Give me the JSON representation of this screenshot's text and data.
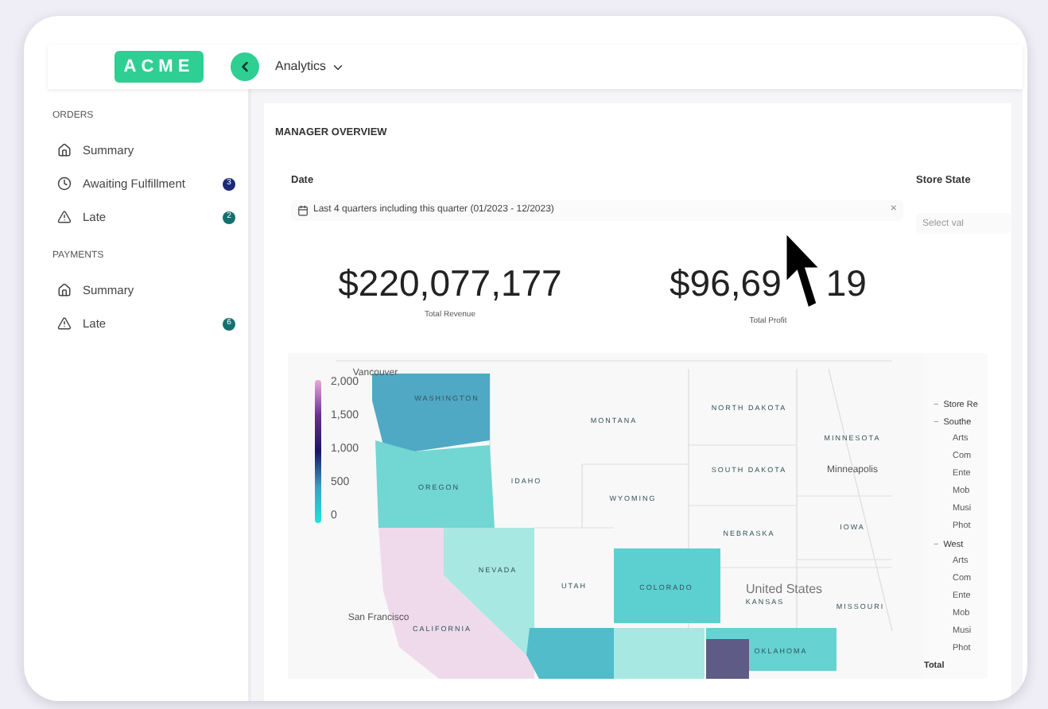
{
  "header": {
    "logo": "ACME",
    "menu": "Analytics"
  },
  "sidebar": {
    "sections": [
      {
        "title": "ORDERS",
        "items": [
          {
            "kind": "home",
            "label": "Summary"
          },
          {
            "kind": "clock",
            "label": "Awaiting Fulfillment",
            "badge": "3",
            "color": "#1e2a78"
          },
          {
            "kind": "warning",
            "label": "Late",
            "badge": "2",
            "color": "#14706e"
          }
        ]
      },
      {
        "title": "PAYMENTS",
        "items": [
          {
            "kind": "home",
            "label": "Summary"
          },
          {
            "kind": "warning",
            "label": "Late",
            "badge": "6",
            "color": "#14706e"
          }
        ]
      }
    ]
  },
  "page": {
    "title": "MANAGER OVERVIEW",
    "date_filter": {
      "label": "Date",
      "value": "Last 4 quarters including this quarter (01/2023 - 12/2023)",
      "clear": "×"
    },
    "store_filter": {
      "label": "Store State",
      "placeholder": "Select val"
    },
    "stats": [
      {
        "value_parts": [
          "$220,077,177"
        ],
        "caption": "Total Revenue"
      },
      {
        "value_parts": [
          "$96,69",
          "19"
        ],
        "caption": "Total Profit"
      }
    ],
    "legend": {
      "ticks": [
        "2,000",
        "1,500",
        "1,000",
        "500",
        "0"
      ]
    },
    "map_labels": [
      {
        "text": "Vancouver",
        "kind": "city"
      },
      {
        "text": "WASHINGTON",
        "kind": "state"
      },
      {
        "text": "MONTANA",
        "kind": "state"
      },
      {
        "text": "NORTH DAKOTA",
        "kind": "state"
      },
      {
        "text": "MINNESOTA",
        "kind": "state"
      },
      {
        "text": "SOUTH DAKOTA",
        "kind": "state"
      },
      {
        "text": "Minneapolis",
        "kind": "city"
      },
      {
        "text": "IDAHO",
        "kind": "state"
      },
      {
        "text": "OREGON",
        "kind": "state"
      },
      {
        "text": "WYOMING",
        "kind": "state"
      },
      {
        "text": "NEBRASKA",
        "kind": "state"
      },
      {
        "text": "IOWA",
        "kind": "state"
      },
      {
        "text": "NEVADA",
        "kind": "state"
      },
      {
        "text": "UTAH",
        "kind": "state"
      },
      {
        "text": "COLORADO",
        "kind": "state"
      },
      {
        "text": "United States",
        "kind": "country"
      },
      {
        "text": "KANSAS",
        "kind": "state"
      },
      {
        "text": "MISSOURI",
        "kind": "state"
      },
      {
        "text": "San Francisco",
        "kind": "city"
      },
      {
        "text": "CALIFORNIA",
        "kind": "state"
      },
      {
        "text": "OKLAHOMA",
        "kind": "state"
      }
    ],
    "tree": [
      {
        "toggle": "−",
        "label": "Store Re",
        "expanded": true
      },
      {
        "toggle": "−",
        "label": "Southe",
        "expanded": true,
        "children": [
          {
            "label": "Arts"
          },
          {
            "label": "Com"
          },
          {
            "label": "Ente"
          },
          {
            "label": "Mob"
          },
          {
            "label": "Musi"
          },
          {
            "label": "Phot"
          }
        ]
      },
      {
        "toggle": "−",
        "label": "West",
        "expanded": true,
        "children": [
          {
            "label": "Arts"
          },
          {
            "label": "Com"
          },
          {
            "label": "Ente"
          },
          {
            "label": "Mob"
          },
          {
            "label": "Musi"
          },
          {
            "label": "Phot"
          }
        ]
      }
    ],
    "total": "Total"
  }
}
